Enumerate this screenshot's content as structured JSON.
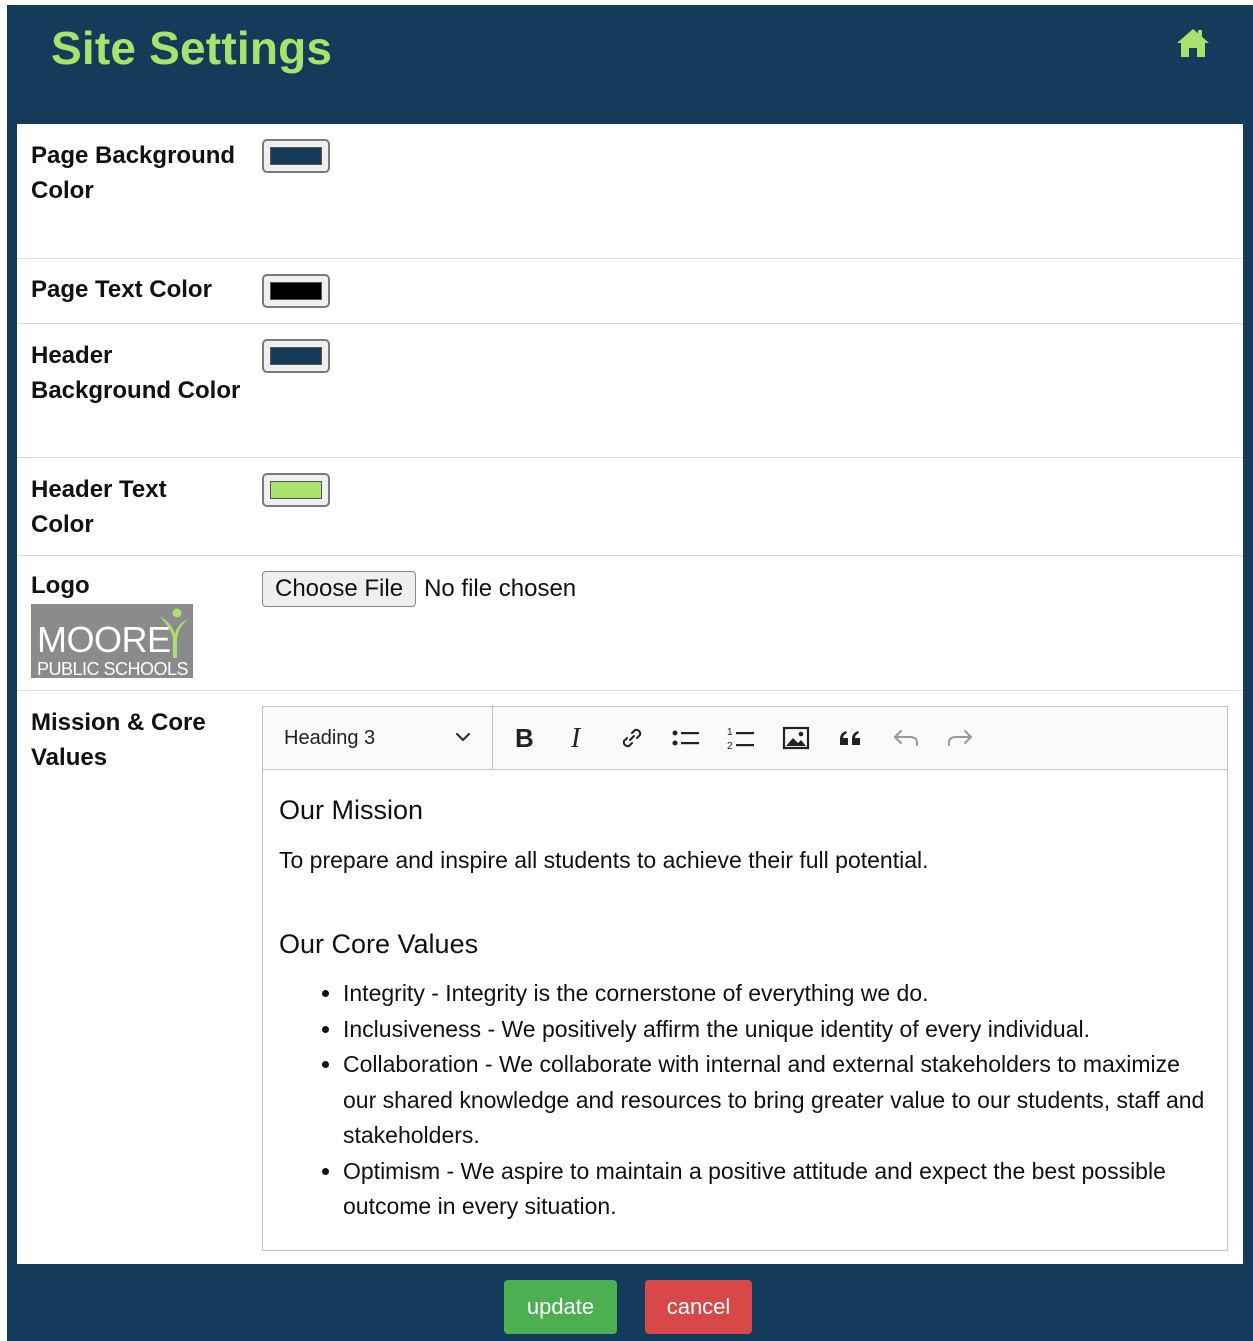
{
  "header": {
    "title": "Site Settings",
    "home_icon": "home-icon",
    "title_color": "#a8e26c",
    "background_color": "#143b59"
  },
  "fields": {
    "page_background_color": {
      "label": "Page Background Color",
      "value": "#143b59"
    },
    "page_text_color": {
      "label": "Page Text Color",
      "value": "#000000"
    },
    "header_background_color": {
      "label": "Header Background Color",
      "value": "#143b59"
    },
    "header_text_color": {
      "label": "Header Text Color",
      "value": "#a8e26c"
    },
    "logo": {
      "label": "Logo",
      "button_label": "Choose File",
      "status": "No file chosen",
      "logo_text": "MOORE",
      "logo_subtext": "PUBLIC SCHOOLS"
    },
    "mission": {
      "label": "Mission & Core Values"
    }
  },
  "editor": {
    "heading_select": "Heading 3",
    "toolbar_icons": [
      "bold-icon",
      "italic-icon",
      "link-icon",
      "bulleted-list-icon",
      "numbered-list-icon",
      "image-icon",
      "blockquote-icon",
      "undo-icon",
      "redo-icon"
    ],
    "mission_heading": "Our Mission",
    "mission_text": "To prepare and inspire all students to achieve their full potential.",
    "values_heading": "Our Core Values",
    "values": [
      "Integrity - Integrity is the cornerstone of everything we do.",
      "Inclusiveness - We positively affirm the unique identity of every individual.",
      "Collaboration - We collaborate with internal and external stakeholders to maximize our shared knowledge and resources to bring greater value to our students, staff and stakeholders.",
      "Optimism - We aspire to maintain a positive attitude and expect the best possible outcome in every situation."
    ]
  },
  "footer": {
    "update_label": "update",
    "cancel_label": "cancel",
    "update_color": "#4cb050",
    "cancel_color": "#d84848"
  }
}
